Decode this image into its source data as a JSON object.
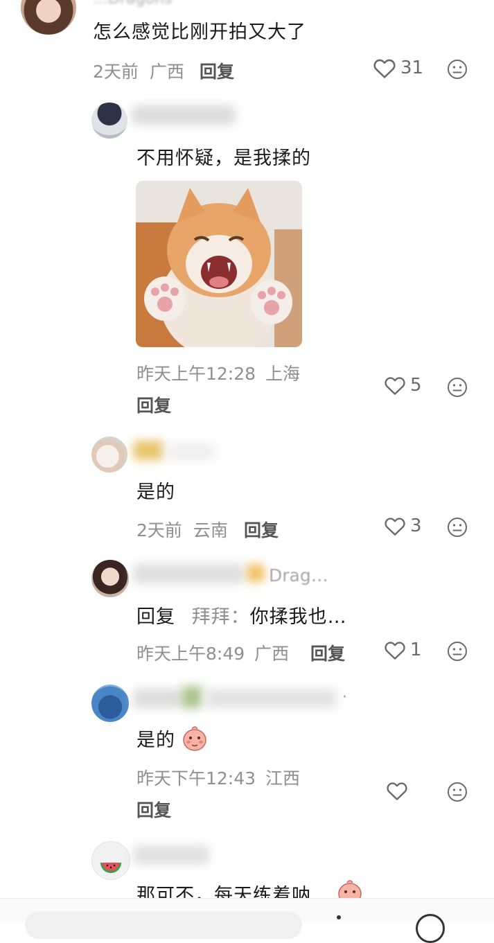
{
  "comments": [
    {
      "text": "怎么感觉比刚开拍又大了",
      "time": "2天前",
      "location": "广西",
      "reply": "回复",
      "likes": "31",
      "partial_name": "...Dragons"
    },
    {
      "text": "不用怀疑，是我揉的",
      "time": "昨天上午12:28",
      "location": "上海",
      "reply": "回复",
      "likes": "5"
    },
    {
      "text": "是的",
      "time": "2天前",
      "location": "云南",
      "reply": "回复",
      "likes": "3"
    },
    {
      "name_tail": "Drag…",
      "reply_prefix": "回复",
      "reply_to": "拜拜：",
      "text": "你揉我也…",
      "time": "昨天上午8:49",
      "location": "广西",
      "reply": "回复",
      "likes": "1"
    },
    {
      "text": "是的",
      "time": "昨天下午12:43",
      "location": "江西",
      "reply": "回复",
      "likes": ""
    },
    {
      "text": "那可不，每天练着呐"
    }
  ],
  "icons": {
    "like": "heart-outline-icon",
    "emoji": "face-neutral-icon",
    "sticker": "blushing-emoji-icon"
  }
}
